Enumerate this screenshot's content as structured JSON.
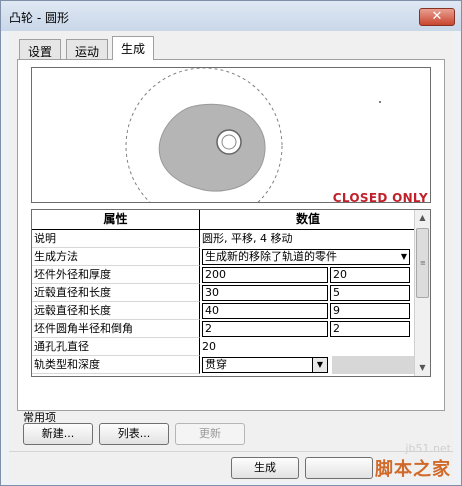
{
  "window": {
    "title": "凸轮 - 圆形",
    "close_label": "✕"
  },
  "tabs": [
    {
      "label": "设置"
    },
    {
      "label": "运动"
    },
    {
      "label": "生成"
    }
  ],
  "preview": {
    "status_text": "CLOSED ONLY"
  },
  "grid": {
    "headers": {
      "property": "属性",
      "value": "数值"
    },
    "rows": [
      {
        "name": "说明",
        "value": "圆形, 平移, 4 移动"
      },
      {
        "name": "生成方法",
        "value": "生成新的移除了轨道的零件"
      },
      {
        "name": "坯件外径和厚度",
        "value1": "200",
        "value2": "20"
      },
      {
        "name": "近毂直径和长度",
        "value1": "30",
        "value2": "5"
      },
      {
        "name": "远毂直径和长度",
        "value1": "40",
        "value2": "9"
      },
      {
        "name": "坯件圆角半径和倒角",
        "value1": "2",
        "value2": "2"
      },
      {
        "name": "通孔孔直径",
        "value": "20"
      },
      {
        "name": "轨类型和深度",
        "value": "贯穿"
      }
    ]
  },
  "common": {
    "label": "常用项",
    "new_button": "新建...",
    "list_button": "列表...",
    "update_button": "更新"
  },
  "footer": {
    "generate_button": "生成"
  },
  "watermark": {
    "site": "jb51.net",
    "name": "脚本之家"
  }
}
